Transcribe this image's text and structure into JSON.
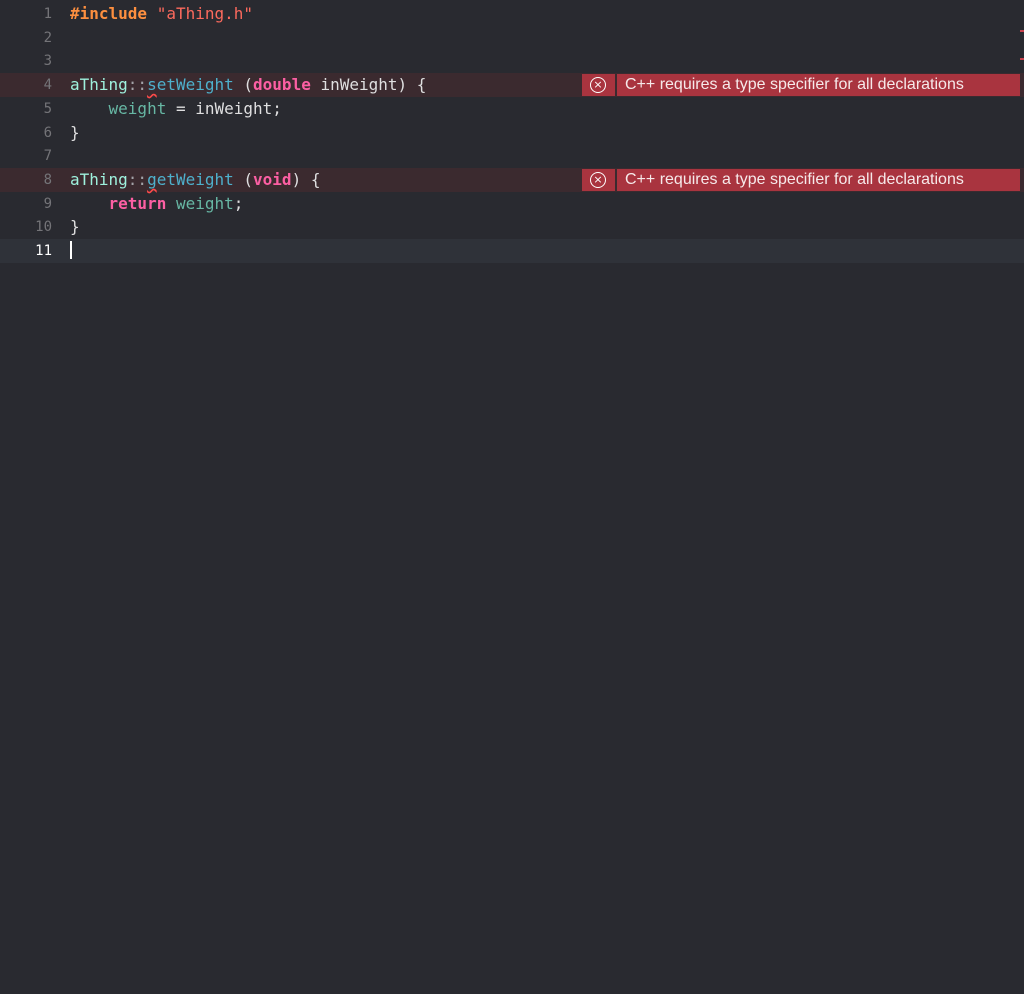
{
  "editor": {
    "lines": [
      {
        "number": "1",
        "tokens": [
          {
            "t": "#include",
            "c": "pre"
          },
          {
            "t": " ",
            "c": "plain"
          },
          {
            "t": "\"aThing.h\"",
            "c": "str"
          }
        ]
      },
      {
        "number": "2",
        "tokens": []
      },
      {
        "number": "3",
        "tokens": []
      },
      {
        "number": "4",
        "tokens": [
          {
            "t": "aThing",
            "c": "type"
          },
          {
            "t": "::",
            "c": "punct"
          },
          {
            "t": "s",
            "c": "func",
            "squiggle": true
          },
          {
            "t": "etWeight",
            "c": "func"
          },
          {
            "t": " (",
            "c": "plain"
          },
          {
            "t": "double",
            "c": "kw"
          },
          {
            "t": " inWeight) {",
            "c": "plain"
          }
        ],
        "error": "C++ requires a type specifier for all declarations"
      },
      {
        "number": "5",
        "tokens": [
          {
            "t": "    ",
            "c": "plain"
          },
          {
            "t": "weight",
            "c": "var"
          },
          {
            "t": " = inWeight;",
            "c": "plain"
          }
        ]
      },
      {
        "number": "6",
        "tokens": [
          {
            "t": "}",
            "c": "plain"
          }
        ]
      },
      {
        "number": "7",
        "tokens": []
      },
      {
        "number": "8",
        "tokens": [
          {
            "t": "aThing",
            "c": "type"
          },
          {
            "t": "::",
            "c": "punct"
          },
          {
            "t": "g",
            "c": "func",
            "squiggle": true
          },
          {
            "t": "etWeight",
            "c": "func"
          },
          {
            "t": " (",
            "c": "plain"
          },
          {
            "t": "void",
            "c": "kw"
          },
          {
            "t": ") {",
            "c": "plain"
          }
        ],
        "error": "C++ requires a type specifier for all declarations"
      },
      {
        "number": "9",
        "tokens": [
          {
            "t": "    ",
            "c": "plain"
          },
          {
            "t": "return",
            "c": "kw"
          },
          {
            "t": " ",
            "c": "plain"
          },
          {
            "t": "weight",
            "c": "var"
          },
          {
            "t": ";",
            "c": "plain"
          }
        ]
      },
      {
        "number": "10",
        "tokens": [
          {
            "t": "}",
            "c": "plain"
          }
        ]
      },
      {
        "number": "11",
        "tokens": [],
        "current": true
      }
    ]
  },
  "colors": {
    "background": "#292a30",
    "error_banner": "#a9343f",
    "error_line": "#3b2a2f",
    "current_line": "#2f3239"
  },
  "icons": {
    "error": "error-circle-x-icon"
  }
}
